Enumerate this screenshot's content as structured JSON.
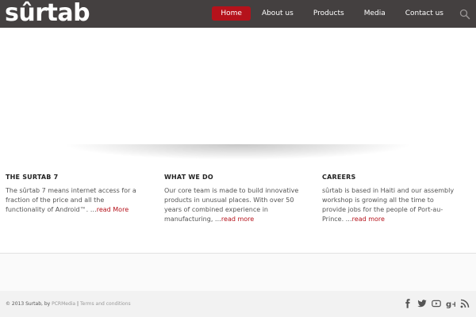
{
  "header": {
    "logo_text": "sûrtab",
    "nav": [
      {
        "label": "Home",
        "active": true
      },
      {
        "label": "About us"
      },
      {
        "label": "Products"
      },
      {
        "label": "Media"
      },
      {
        "label": "Contact us"
      }
    ],
    "search_icon": "search-icon"
  },
  "colors": {
    "accent": "#b5121b",
    "header_bg": "#444040"
  },
  "features": [
    {
      "title": "THE SURTAB 7",
      "body": "The sûrtab 7 means internet access for a fraction of the price and all the functionality of Android™. …",
      "link": "read More"
    },
    {
      "title": "WHAT WE DO",
      "body": "Our core team is made to build innovative products in unusual places. With over 50 years of combined experience in manufacturing, …",
      "link": "read more"
    },
    {
      "title": "CAREERS",
      "body": "sûrtab is based in Haiti and our assembly workshop is growing all the time to provide jobs for the people of Port-au-Prince. …",
      "link": "read more"
    }
  ],
  "footer": {
    "copyright_prefix": "© 2013 Surtab, by",
    "pcr_link": "PCRMedia",
    "separator": "|",
    "terms_link": "Terms and conditions",
    "social_icons": [
      "facebook-icon",
      "twitter-icon",
      "youtube-icon",
      "google-plus-icon",
      "rss-icon"
    ]
  }
}
